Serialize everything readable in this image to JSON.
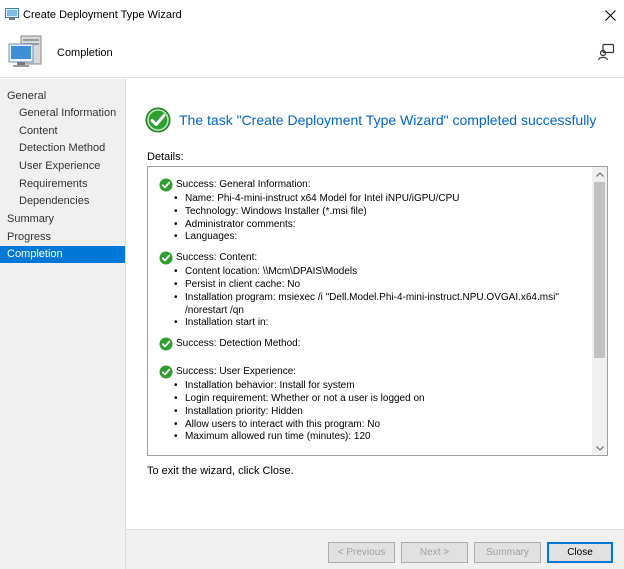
{
  "window": {
    "title": "Create Deployment Type Wizard"
  },
  "header": {
    "page_name": "Completion"
  },
  "sidebar": {
    "items": [
      {
        "label": "General",
        "level": 0
      },
      {
        "label": "General Information",
        "level": 1
      },
      {
        "label": "Content",
        "level": 1
      },
      {
        "label": "Detection Method",
        "level": 1
      },
      {
        "label": "User Experience",
        "level": 1
      },
      {
        "label": "Requirements",
        "level": 1
      },
      {
        "label": "Dependencies",
        "level": 1
      },
      {
        "label": "Summary",
        "level": 0
      },
      {
        "label": "Progress",
        "level": 0
      },
      {
        "label": "Completion",
        "level": 0,
        "active": true
      }
    ]
  },
  "main": {
    "status_message": "The task \"Create Deployment Type Wizard\" completed successfully",
    "details_label": "Details:",
    "sections": [
      {
        "heading": "Success: General Information:",
        "items": [
          "Name: Phi-4-mini-instruct x64 Model for Intel iNPU/iGPU/CPU",
          "Technology: Windows Installer (*.msi file)",
          "Administrator comments:",
          "Languages:"
        ]
      },
      {
        "heading": "Success: Content:",
        "items": [
          "Content location: \\\\Mcm\\DPAIS\\Models",
          "Persist in client cache: No",
          "Installation program: msiexec /i \"Dell.Model.Phi-4-mini-instruct.NPU.OVGAI.x64.msi\" /norestart /qn",
          "Installation start in:"
        ]
      },
      {
        "heading": "Success: Detection Method:",
        "items": []
      },
      {
        "heading": "Success: User Experience:",
        "items": [
          "Installation behavior: Install for system",
          "Login requirement: Whether or not a user is logged on",
          "Installation priority: Hidden",
          "Allow users to interact with this program: No",
          "Maximum allowed run time (minutes): 120"
        ]
      }
    ],
    "exit_text": "To exit the wizard, click Close."
  },
  "footer": {
    "previous_label": "< Previous",
    "next_label": "Next >",
    "summary_label": "Summary",
    "close_label": "Close"
  },
  "colors": {
    "accent": "#0078d7",
    "status_text": "#0066cc",
    "success_green": "#2e9e2e"
  }
}
